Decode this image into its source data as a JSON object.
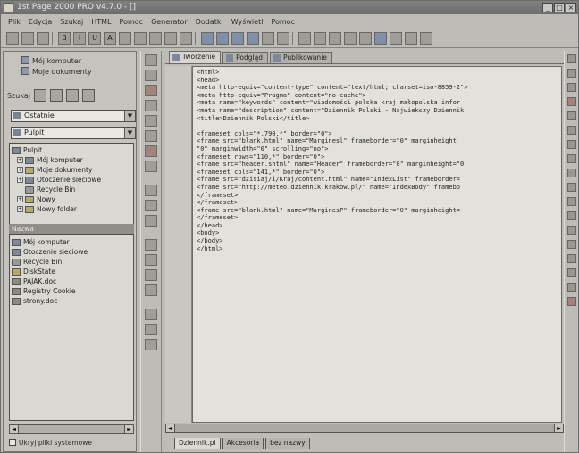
{
  "window": {
    "title": "1st Page 2000 PRO v4.7.0 - []",
    "buttons": [
      "_",
      "□",
      "×"
    ]
  },
  "menu": [
    "Plik",
    "Edycja",
    "Szukaj",
    "HTML",
    "Pomoc",
    "Generator",
    "Dodatki",
    "Wyświetl",
    "Pomoc"
  ],
  "toolbar": {
    "icons": [
      "new-icon",
      "open-icon",
      "save-icon",
      "bold-icon",
      "italic-icon",
      "underline-icon",
      "font-icon",
      "align-left-icon",
      "align-center-icon",
      "align-right-icon",
      "list-icon",
      "indent-icon",
      "image-icon",
      "link-icon",
      "table-icon",
      "frame-icon",
      "form-icon",
      "color-icon",
      "preview-icon",
      "browser-icon",
      "help-icon"
    ]
  },
  "left_panel": {
    "links": [
      "Mój komputer",
      "Moje dokumenty"
    ],
    "source_label": "Szukaj",
    "combo1": "Ostatnie",
    "combo2": "Pulpit",
    "tree": [
      {
        "label": "Pulpit",
        "indent": 0,
        "icon": "desktop"
      },
      {
        "label": "Mój komputer",
        "indent": 1,
        "icon": "pc"
      },
      {
        "label": "Moje dokumenty",
        "indent": 1,
        "icon": "folder"
      },
      {
        "label": "Otoczenie sieciowe",
        "indent": 1,
        "icon": "network"
      },
      {
        "label": "Recycle Bin",
        "indent": 1,
        "icon": "bin"
      },
      {
        "label": "Nowy",
        "indent": 1,
        "icon": "folder"
      },
      {
        "label": "Nowy folder",
        "indent": 1,
        "icon": "folder"
      }
    ],
    "list_header": "Nazwa",
    "list": [
      "Mój komputer",
      "Otoczenie sieciowe",
      "Recycle Bin",
      "DiskState",
      "PAJAK.doc",
      "Registry Cookie",
      "strony.doc"
    ],
    "checkbox_label": "Ukryj pliki systemowe"
  },
  "editor": {
    "tabs": [
      "Tworzenie",
      "Podgląd",
      "Publikowanie"
    ],
    "lines": [
      "<html>",
      "<head>",
      "<meta http-equiv=\"content-type\" content=\"text/html; charset=iso-8859-2\">",
      "<meta http-equiv=\"Pragma\" content=\"no-cache\">",
      "<meta name=\"keywords\" content=\"wiadomości polska kraj małopolska infor",
      "<meta name=\"description\" content=\"Dziennik Polski - Najwiekszy Dziennik",
      "<title>Dziennik Polski</title>",
      "",
      "<frameset cols=\"*,790,*\" border=\"0\">",
      "<frame src=\"blank.html\" name=\"Marginesl\" frameborder=\"0\" marginheight",
      "\"0\" marginwidth=\"0\" scrolling=\"no\">",
      "<frameset rows=\"110,*\" border=\"0\">",
      "<frame src=\"header.shtml\" name=\"Header\" frameborder=\"0\" marginheight=\"0",
      "<frameset cols=\"141,*\" border=\"0\">",
      "<frame src=\"dzisiaj/i/Kraj/content.html\" name=\"IndexList\" frameborder=",
      "<frame src=\"http://meteo.dziennik.krakow.pl/\" name=\"IndexBody\" framebo",
      "</frameset>",
      "</frameset>",
      "<frame src=\"blank.html\" name=\"MarginesP\" frameborder=\"0\" marginheight=",
      "</frameset>",
      "</head>",
      "<body>",
      "</body>",
      "</html>"
    ],
    "bottom_tabs": [
      "Dziennik.pl",
      "Akcesoria",
      "bez nazwy"
    ]
  }
}
